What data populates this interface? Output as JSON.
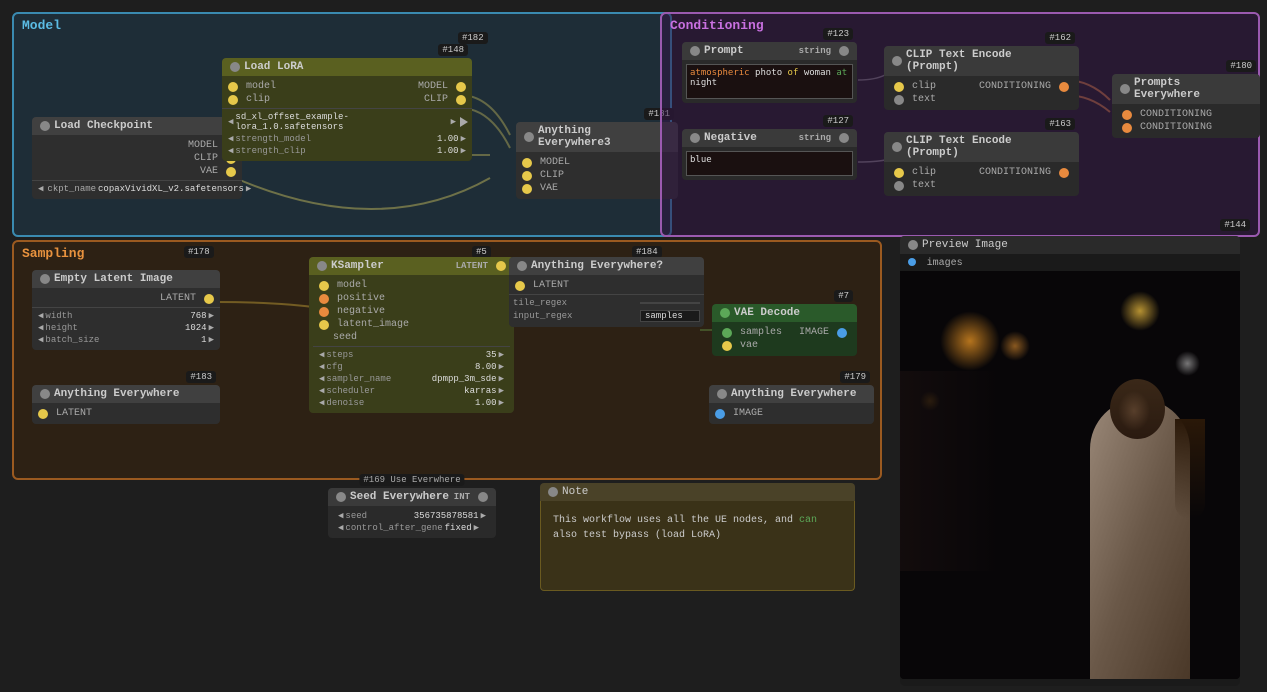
{
  "sections": {
    "model": {
      "title": "Model"
    },
    "conditioning": {
      "title": "Conditioning"
    },
    "sampling": {
      "title": "Sampling"
    }
  },
  "nodes": {
    "load_checkpoint": {
      "id": "",
      "title": "Load Checkpoint",
      "outputs": [
        "MODEL",
        "CLIP",
        "VAE"
      ],
      "ckpt_name": "copaxVividXL_v2.safetensors"
    },
    "load_lora": {
      "id": "#148",
      "title": "Load LoRA",
      "inputs": [
        "model",
        "clip"
      ],
      "outputs": [
        "MODEL",
        "CLIP"
      ],
      "filename": "sd_xl_offset_example-lora_1.0.safetensors",
      "strength_model": "1.00",
      "strength_clip": "1.00"
    },
    "anything_everywhere3": {
      "id": "#181",
      "title": "Anything Everywhere3",
      "inputs": [
        "MODEL",
        "CLIP",
        "VAE"
      ]
    },
    "node_182": {
      "id": "#182"
    },
    "node_183": {
      "id": "#183"
    },
    "node_184": {
      "id": "#184"
    },
    "node_5": {
      "id": "#5"
    },
    "node_178": {
      "id": "#178"
    },
    "prompt": {
      "id": "",
      "title": "Prompt",
      "text": "atmospheric photo of woman at night",
      "output": "string"
    },
    "negative": {
      "id": "",
      "title": "Negative",
      "text": "blue",
      "output": "string"
    },
    "clip_text_encode_1": {
      "id": "#162",
      "title": "CLIP Text Encode (Prompt)",
      "inputs": [
        "clip",
        "text"
      ],
      "outputs": [
        "CONDITIONING"
      ]
    },
    "clip_text_encode_2": {
      "id": "#163",
      "title": "CLIP Text Encode (Prompt)",
      "inputs": [
        "clip",
        "text"
      ],
      "outputs": [
        "CONDITIONING"
      ]
    },
    "node_123": {
      "id": "#123"
    },
    "node_127": {
      "id": "#127"
    },
    "prompts_everywhere": {
      "id": "#180",
      "title": "Prompts Everywhere",
      "inputs": [
        "CONDITIONING",
        "CONDITIONING"
      ]
    },
    "empty_latent": {
      "id": "",
      "title": "Empty Latent Image",
      "outputs": [
        "LATENT"
      ],
      "width": "768",
      "height": "1024",
      "batch_size": "1"
    },
    "ksampler": {
      "id": "",
      "title": "KSampler",
      "inputs": [
        "model",
        "positive",
        "negative",
        "latent_image"
      ],
      "outputs": [
        "LATENT"
      ],
      "seed": "",
      "steps": "35",
      "cfg": "8.00",
      "sampler_name": "dpmpp_3m_sde",
      "scheduler": "karras",
      "denoise": "1.00"
    },
    "anything_everywhere_question": {
      "id": "",
      "title": "Anything Everywhere?",
      "inputs": [
        "LATENT"
      ],
      "fields": [
        {
          "label": "tile_regex",
          "value": ""
        },
        {
          "label": "input_regex",
          "value": "samples"
        }
      ]
    },
    "vae_decode": {
      "id": "#7",
      "title": "VAE Decode",
      "inputs": [
        "samples",
        "vae"
      ],
      "outputs": [
        "IMAGE"
      ]
    },
    "anything_everywhere_sampling": {
      "id": "",
      "title": "Anything Everywhere",
      "outputs": [
        "LATENT"
      ]
    },
    "anything_everywhere_vae": {
      "id": "#179",
      "title": "Anything Everywhere",
      "outputs": [
        "IMAGE"
      ]
    },
    "preview_image": {
      "id": "",
      "title": "Preview Image",
      "input": "images"
    },
    "seed_everywhere": {
      "id": "#169",
      "title": "Use Everywhere",
      "subtitle": "Seed Everywhere",
      "seed": "356735878581",
      "control_after": "fixed"
    },
    "note": {
      "id": "",
      "title": "Note",
      "text": "This workflow uses all the UE nodes, and can also test bypass (load LoRA)"
    },
    "node_144": {
      "id": "#144"
    }
  },
  "colors": {
    "model_section": "#3a8ab0",
    "conditioning_section": "#9b5ab0",
    "sampling_section": "#9b5a20",
    "port_yellow": "#e6c84a",
    "port_orange": "#e88a3e",
    "port_green": "#5ca858",
    "port_blue": "#4a9de6",
    "node_olive": "#5a6020",
    "node_teal": "#2a5a56"
  }
}
